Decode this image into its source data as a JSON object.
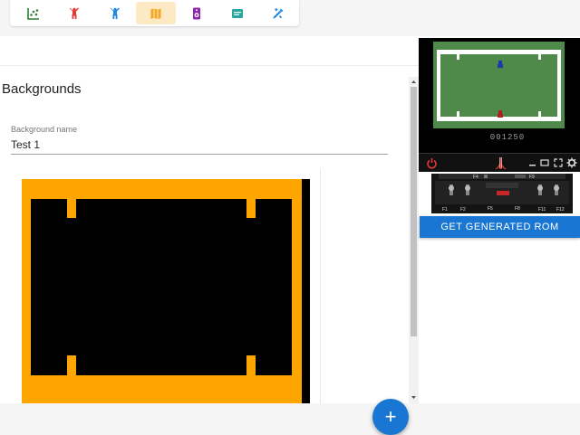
{
  "toolbar": {
    "items": [
      {
        "name": "chart-icon",
        "color": "#2e7d32",
        "active": false
      },
      {
        "name": "player-icon",
        "color": "#e53935",
        "active": false
      },
      {
        "name": "player2-icon",
        "color": "#1e88e5",
        "active": false
      },
      {
        "name": "map-icon",
        "color": "#f5a623",
        "active": true
      },
      {
        "name": "speaker-icon",
        "color": "#8e24aa",
        "active": false
      },
      {
        "name": "message-icon",
        "color": "#26a69a",
        "active": false
      },
      {
        "name": "tools-icon",
        "color": "#1e88e5",
        "active": false
      }
    ]
  },
  "main": {
    "title": "Backgrounds",
    "background_name_label": "Background name",
    "background_name_value": "Test 1",
    "fab_label": "+"
  },
  "playfield": {
    "border_color": "#ffa500",
    "fill_color": "#000000"
  },
  "emulator": {
    "score": "001250",
    "field_color": "#4f8a4a",
    "console_labels": [
      "F4",
      "F9",
      "F1",
      "F2",
      "F5",
      "F8",
      "F11",
      "F12"
    ]
  },
  "rom_button": {
    "label": "GET GENERATED ROM"
  },
  "colors": {
    "accent": "#1976d2"
  }
}
